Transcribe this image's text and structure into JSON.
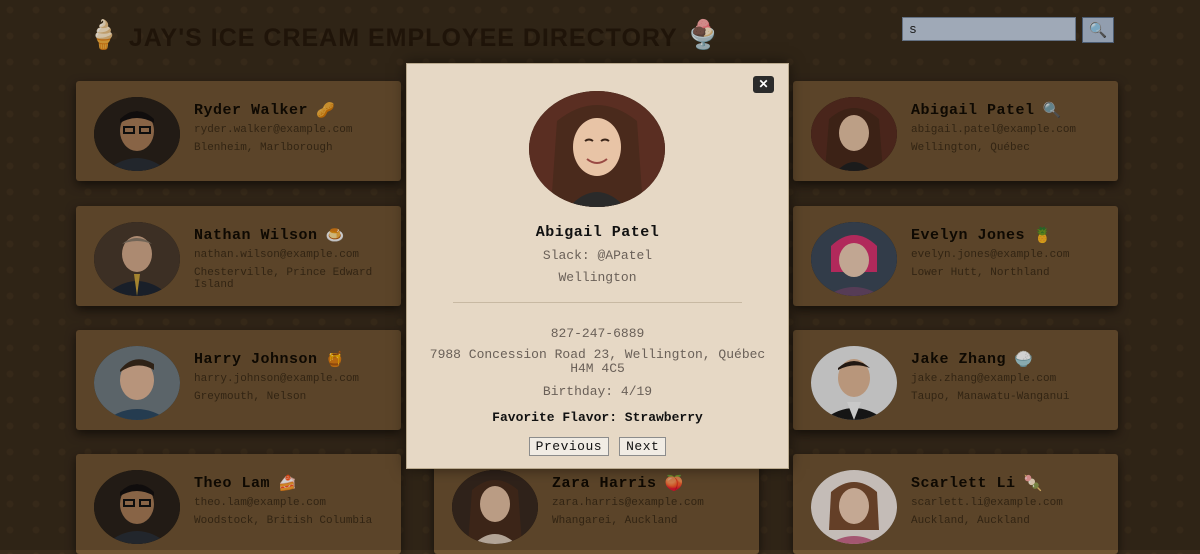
{
  "app": {
    "title": "JAY'S ICE CREAM EMPLOYEE DIRECTORY",
    "left_icon": "ice-cream-cone-icon",
    "right_icon": "sundae-icon",
    "left_glyph": "🍦",
    "right_glyph": "🍨"
  },
  "search": {
    "value": "s",
    "button_glyph": "🔍",
    "button_icon": "search-icon"
  },
  "cards": [
    {
      "name": "Ryder Walker",
      "emoji": "🥜",
      "email": "ryder.walker@example.com",
      "location": "Blenheim, Marlborough"
    },
    {
      "name": "Nathan Wilson",
      "emoji": "🍮",
      "email": "nathan.wilson@example.com",
      "location": "Chesterville, Prince Edward Island"
    },
    {
      "name": "Harry Johnson",
      "emoji": "🍯",
      "email": "harry.johnson@example.com",
      "location": "Greymouth, Nelson"
    },
    {
      "name": "Theo Lam",
      "emoji": "🍰",
      "email": "theo.lam@example.com",
      "location": "Woodstock, British Columbia"
    },
    {
      "name": "Zara Harris",
      "emoji": "🍑",
      "email": "zara.harris@example.com",
      "location": "Whangarei, Auckland"
    },
    {
      "name": "Abigail Patel",
      "emoji": "🔍",
      "email": "abigail.patel@example.com",
      "location": "Wellington, Québec"
    },
    {
      "name": "Evelyn Jones",
      "emoji": "🍍",
      "email": "evelyn.jones@example.com",
      "location": "Lower Hutt, Northland"
    },
    {
      "name": "Jake Zhang",
      "emoji": "🍚",
      "email": "jake.zhang@example.com",
      "location": "Taupo, Manawatu-Wanganui"
    },
    {
      "name": "Scarlett Li",
      "emoji": "🍡",
      "email": "scarlett.li@example.com",
      "location": "Auckland, Auckland"
    }
  ],
  "modal": {
    "close_label": "✕",
    "name": "Abigail Patel",
    "slack": "Slack: @APatel",
    "city": "Wellington",
    "phone": "827-247-6889",
    "address": "7988 Concession Road 23, Wellington, Québec H4M 4C5",
    "birthday": "Birthday: 4/19",
    "flavor": "Favorite Flavor: Strawberry",
    "prev_label": "Previous",
    "next_label": "Next"
  },
  "colors": {
    "background": "#3a2c1c",
    "card": "#6f5432",
    "modal": "#e6d8c5",
    "title": "#26190c"
  }
}
